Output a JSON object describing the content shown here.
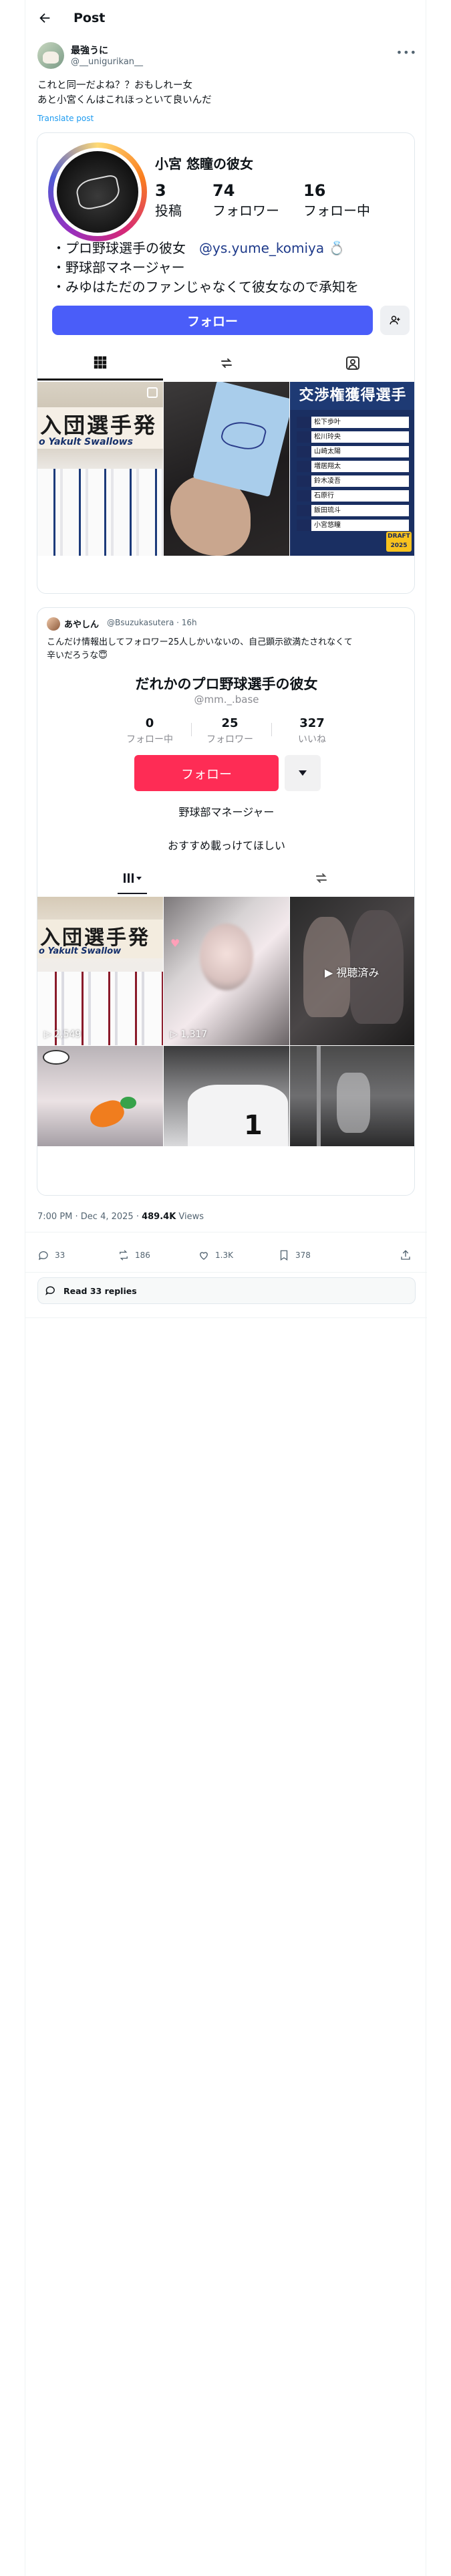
{
  "header": {
    "title": "Post"
  },
  "author": {
    "name": "最強うに",
    "handle": "@__unigurikan__"
  },
  "tweet": {
    "line1": "これと同一だよね？？おもしれー女",
    "line2": "あと小宮くんはこれほっといて良いんだ",
    "translate_label": "Translate post"
  },
  "instagram": {
    "name": "小宮 悠瞳の彼女",
    "stats": [
      {
        "num": "3",
        "label": "投稿"
      },
      {
        "num": "74",
        "label": "フォロワー"
      },
      {
        "num": "16",
        "label": "フォロー中"
      }
    ],
    "bio": {
      "line1": "・プロ野球選手の彼女",
      "mention": "@ys.yume_komiya",
      "ring": "💍",
      "line2": "・野球部マネージャー",
      "line3": "・みゆはただのファンじゃなくて彼女なので承知を"
    },
    "follow_label": "フォロー",
    "grid": [
      {
        "banner": "入団選手発",
        "sub": "o Yakult Swallows"
      },
      {
        "desc": "signed card"
      },
      {
        "header": "交渉権獲得選手",
        "draft_badge": "DRAFT 2025",
        "rows": [
          "松下歩叶",
          "松川玲央",
          "山崎太陽",
          "増居翔太",
          "鈴木凌吾",
          "石原行",
          "飯田琉斗",
          "小宮悠瞳"
        ]
      }
    ]
  },
  "quote": {
    "name": "あやしん",
    "handle": "@Bsuzukasutera",
    "time": "16h",
    "text_line1": "こんだけ情報出してフォロワー25人しかいないの、自己顕示欲満たされなくて",
    "text_line2": "辛いだろうな😇"
  },
  "tiktok": {
    "title": "だれかのプロ野球選手の彼女",
    "username": "@mm._.base",
    "stats": [
      {
        "num": "0",
        "label": "フォロー中"
      },
      {
        "num": "25",
        "label": "フォロワー"
      },
      {
        "num": "327",
        "label": "いいね"
      }
    ],
    "follow_label": "フォロー",
    "bio": "野球部マネージャー",
    "recommend": "おすすめ載っけてほしい",
    "grid": {
      "banner": "入団選手発",
      "sub": "o Yakult Swallow",
      "overlay1": "▷ 2,549",
      "overlay2": "▷ 1,317",
      "overlay3": "▶ 視聴済み",
      "number": "1"
    }
  },
  "meta": {
    "time": "7:00 PM · Dec 4, 2025 · ",
    "views": "489.4K",
    "views_label": " Views"
  },
  "actions": {
    "replies": "33",
    "reposts": "186",
    "likes": "1.3K",
    "bookmarks": "378"
  },
  "read_replies": "Read 33 replies"
}
